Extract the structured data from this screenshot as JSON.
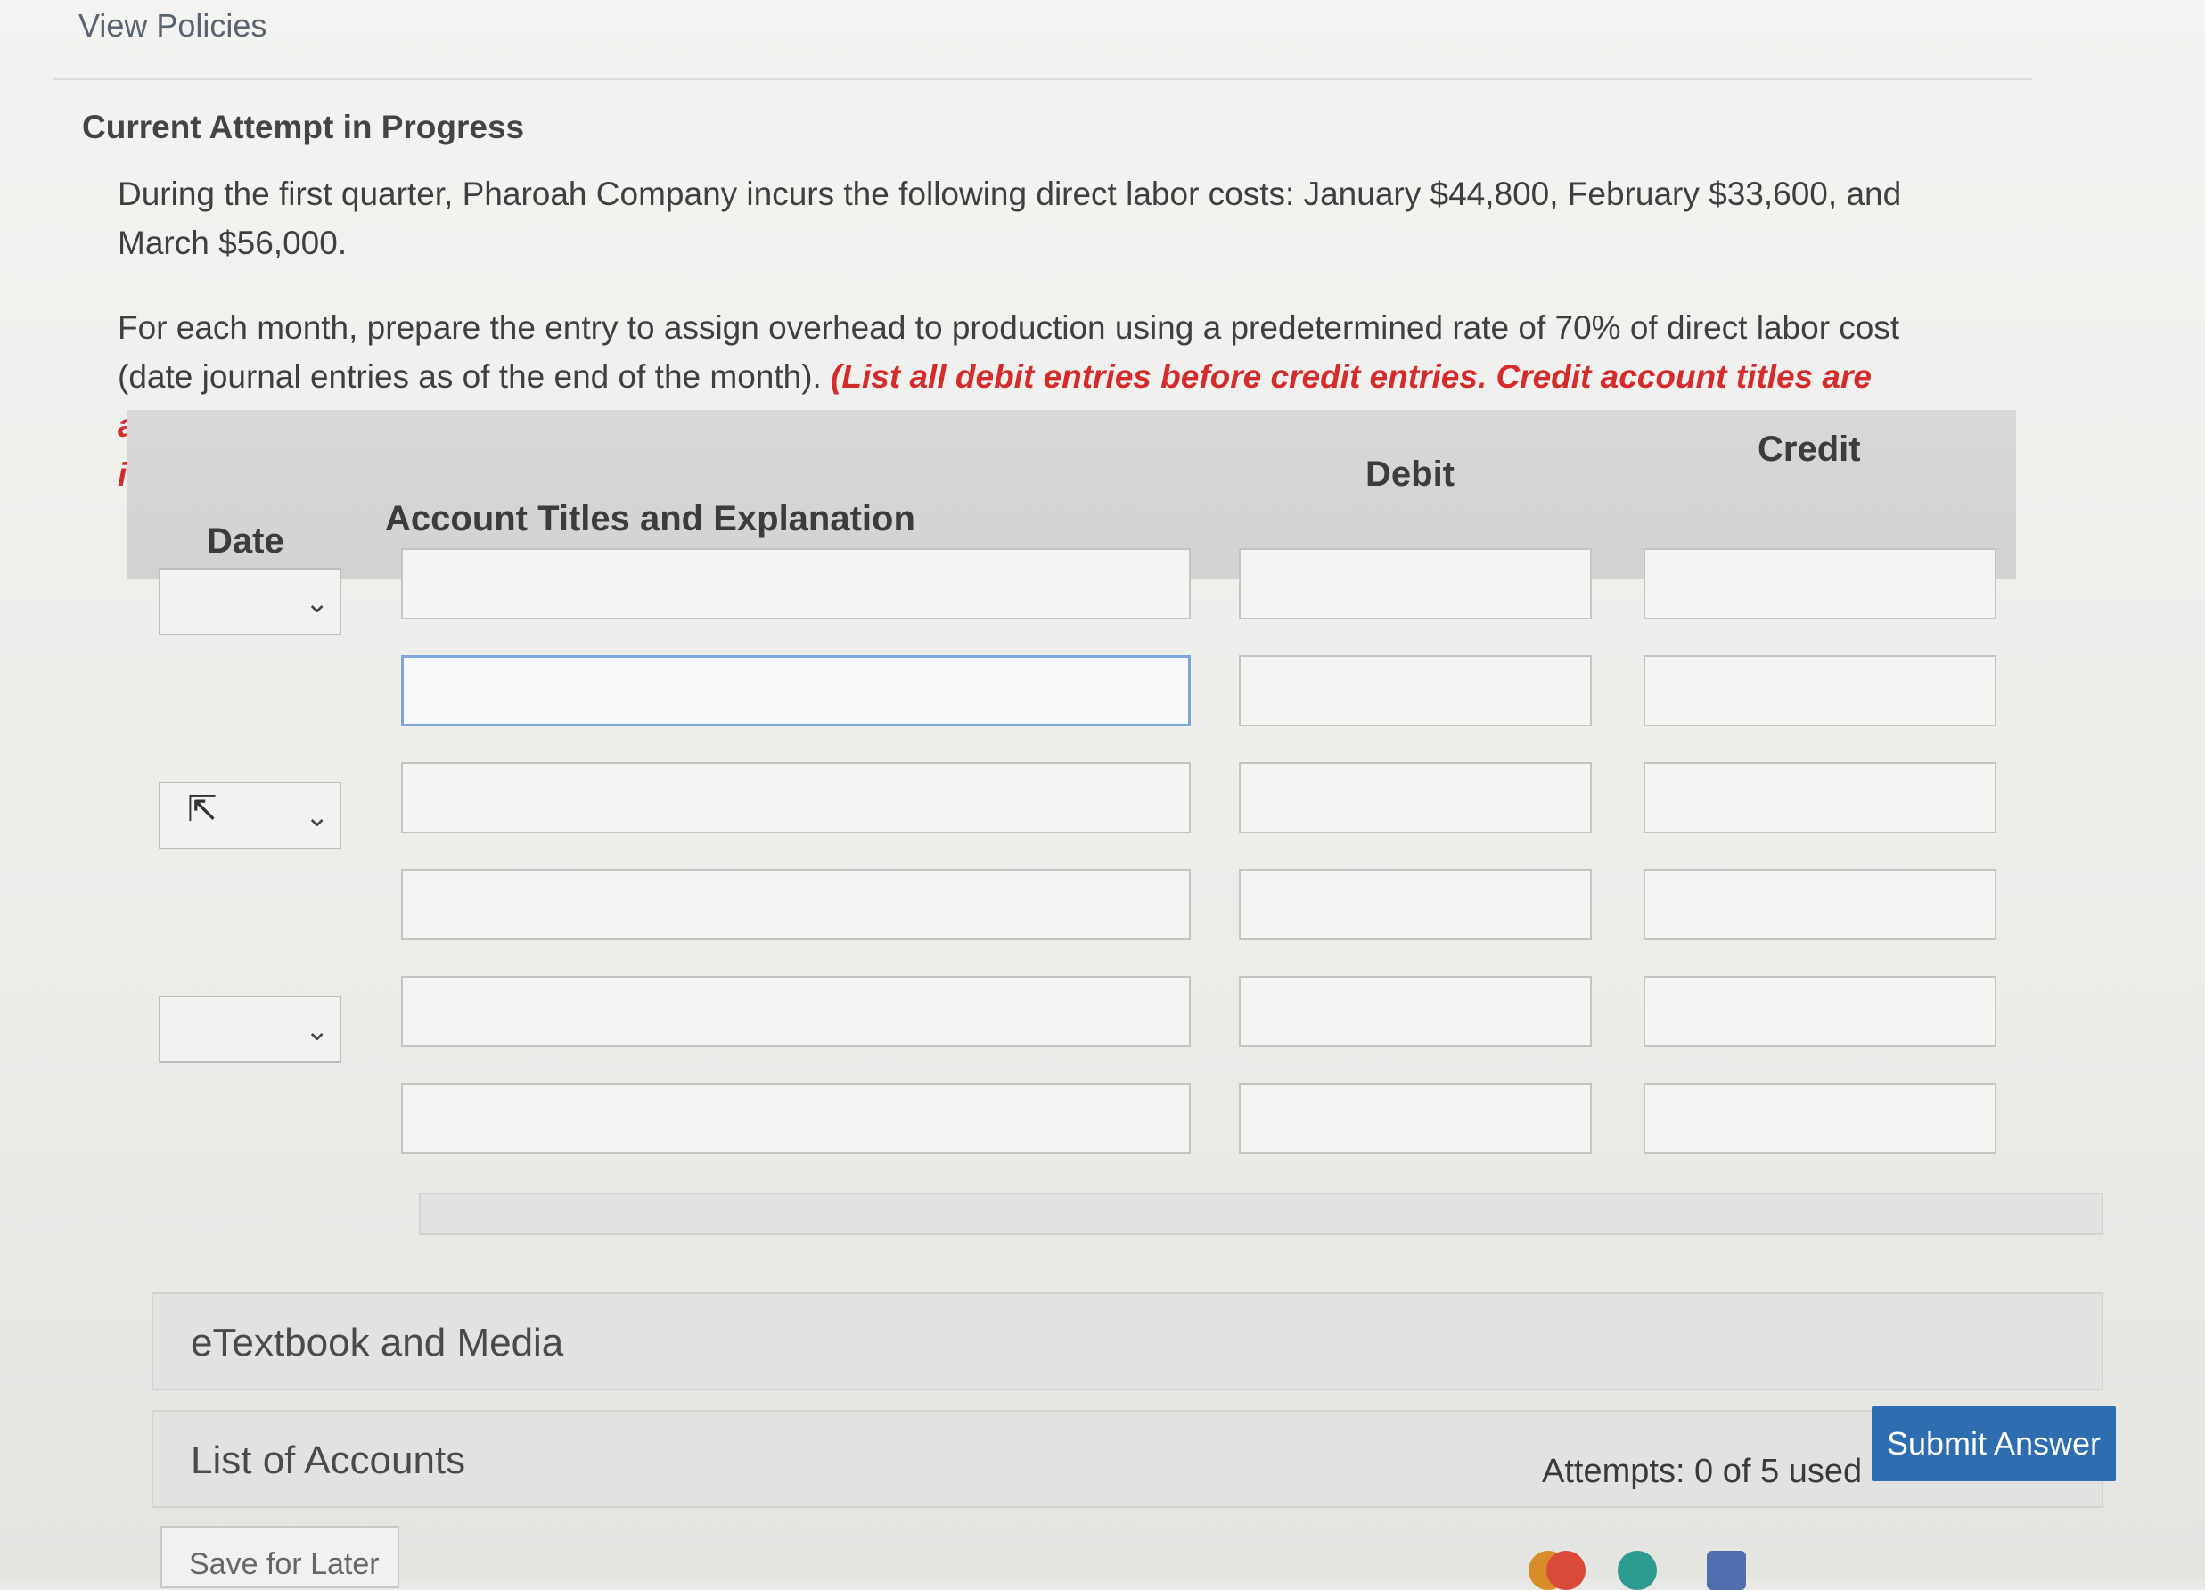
{
  "header": {
    "view_policies": "View Policies",
    "attempt_heading": "Current Attempt in Progress"
  },
  "problem": {
    "statement": "During the first quarter, Pharoah Company incurs the following direct labor costs: January $44,800, February $33,600, and March $56,000.",
    "instruction_plain": "For each month, prepare the entry to assign overhead to production using a predetermined rate of 70% of direct labor cost (date journal entries as of the end of the month). ",
    "instruction_red": "(List all debit entries before credit entries. Credit account titles are automatically indented when amount is entered. Do not indent manually. Record journal entries in the order presented in the problem.)"
  },
  "journal": {
    "col_date": "Date",
    "col_account": "Account Titles and Explanation",
    "col_debit": "Debit",
    "col_credit": "Credit",
    "date_selects": [
      "",
      "",
      ""
    ],
    "rows": [
      {
        "account": "",
        "debit": "",
        "credit": ""
      },
      {
        "account": "",
        "debit": "",
        "credit": ""
      },
      {
        "account": "",
        "debit": "",
        "credit": ""
      },
      {
        "account": "",
        "debit": "",
        "credit": ""
      },
      {
        "account": "",
        "debit": "",
        "credit": ""
      },
      {
        "account": "",
        "debit": "",
        "credit": ""
      }
    ]
  },
  "resources": {
    "etextbook": "eTextbook and Media",
    "list_of_accounts": "List of Accounts"
  },
  "footer": {
    "attempts": "Attempts: 0 of 5 used",
    "submit": "Submit Answer",
    "save_later": "Save for Later"
  },
  "icons": {
    "chevron": "chevron-down-icon",
    "cursor": "mouse-pointer-icon"
  },
  "colors": {
    "instruction_red": "#d52b2b",
    "submit_blue": "#2f6db1",
    "focus_blue": "#7fa6d8"
  }
}
